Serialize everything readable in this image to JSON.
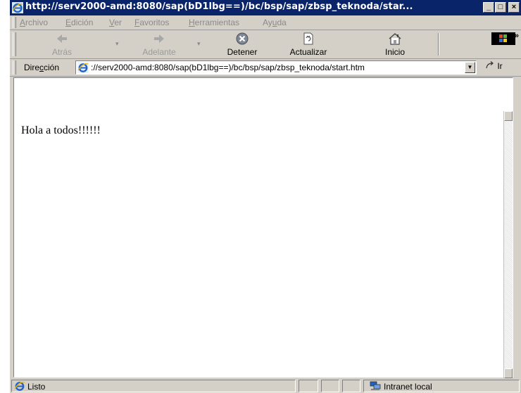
{
  "window": {
    "title": "http://serv2000-amd:8080/sap(bD1lbg==)/bc/bsp/sap/zbsp_teknoda/star...",
    "min_glyph": "_",
    "max_glyph": "□",
    "close_glyph": "×"
  },
  "menu": {
    "items": [
      {
        "prefix": "",
        "accel": "A",
        "rest": "rchivo"
      },
      {
        "prefix": "",
        "accel": "E",
        "rest": "dición"
      },
      {
        "prefix": "",
        "accel": "V",
        "rest": "er"
      },
      {
        "prefix": "",
        "accel": "F",
        "rest": "avoritos"
      },
      {
        "prefix": "",
        "accel": "H",
        "rest": "erramientas"
      },
      {
        "prefix": "Ay",
        "accel": "u",
        "rest": "da"
      }
    ]
  },
  "toolbar": {
    "back_label": "Atrás",
    "forward_label": "Adelante",
    "stop_label": "Detener",
    "refresh_label": "Actualizar",
    "home_label": "Inicio",
    "chevron": "»"
  },
  "address": {
    "label_prefix": "Dire",
    "label_accel": "c",
    "label_rest": "ción",
    "url": "://serv2000-amd:8080/sap(bD1lbg==)/bc/bsp/sap/zbsp_teknoda/start.htm",
    "go_label": "Ir"
  },
  "page": {
    "text": "Hola a todos!!!!!!"
  },
  "status": {
    "text": "Listo",
    "zone": "Intranet local"
  },
  "colors": {
    "titlebar": "#0a246a",
    "chrome": "#d4d0c8",
    "disabled_text": "#8a8a8a",
    "stop_icon": "#7f8794",
    "ie_blue": "#1f63c8"
  }
}
